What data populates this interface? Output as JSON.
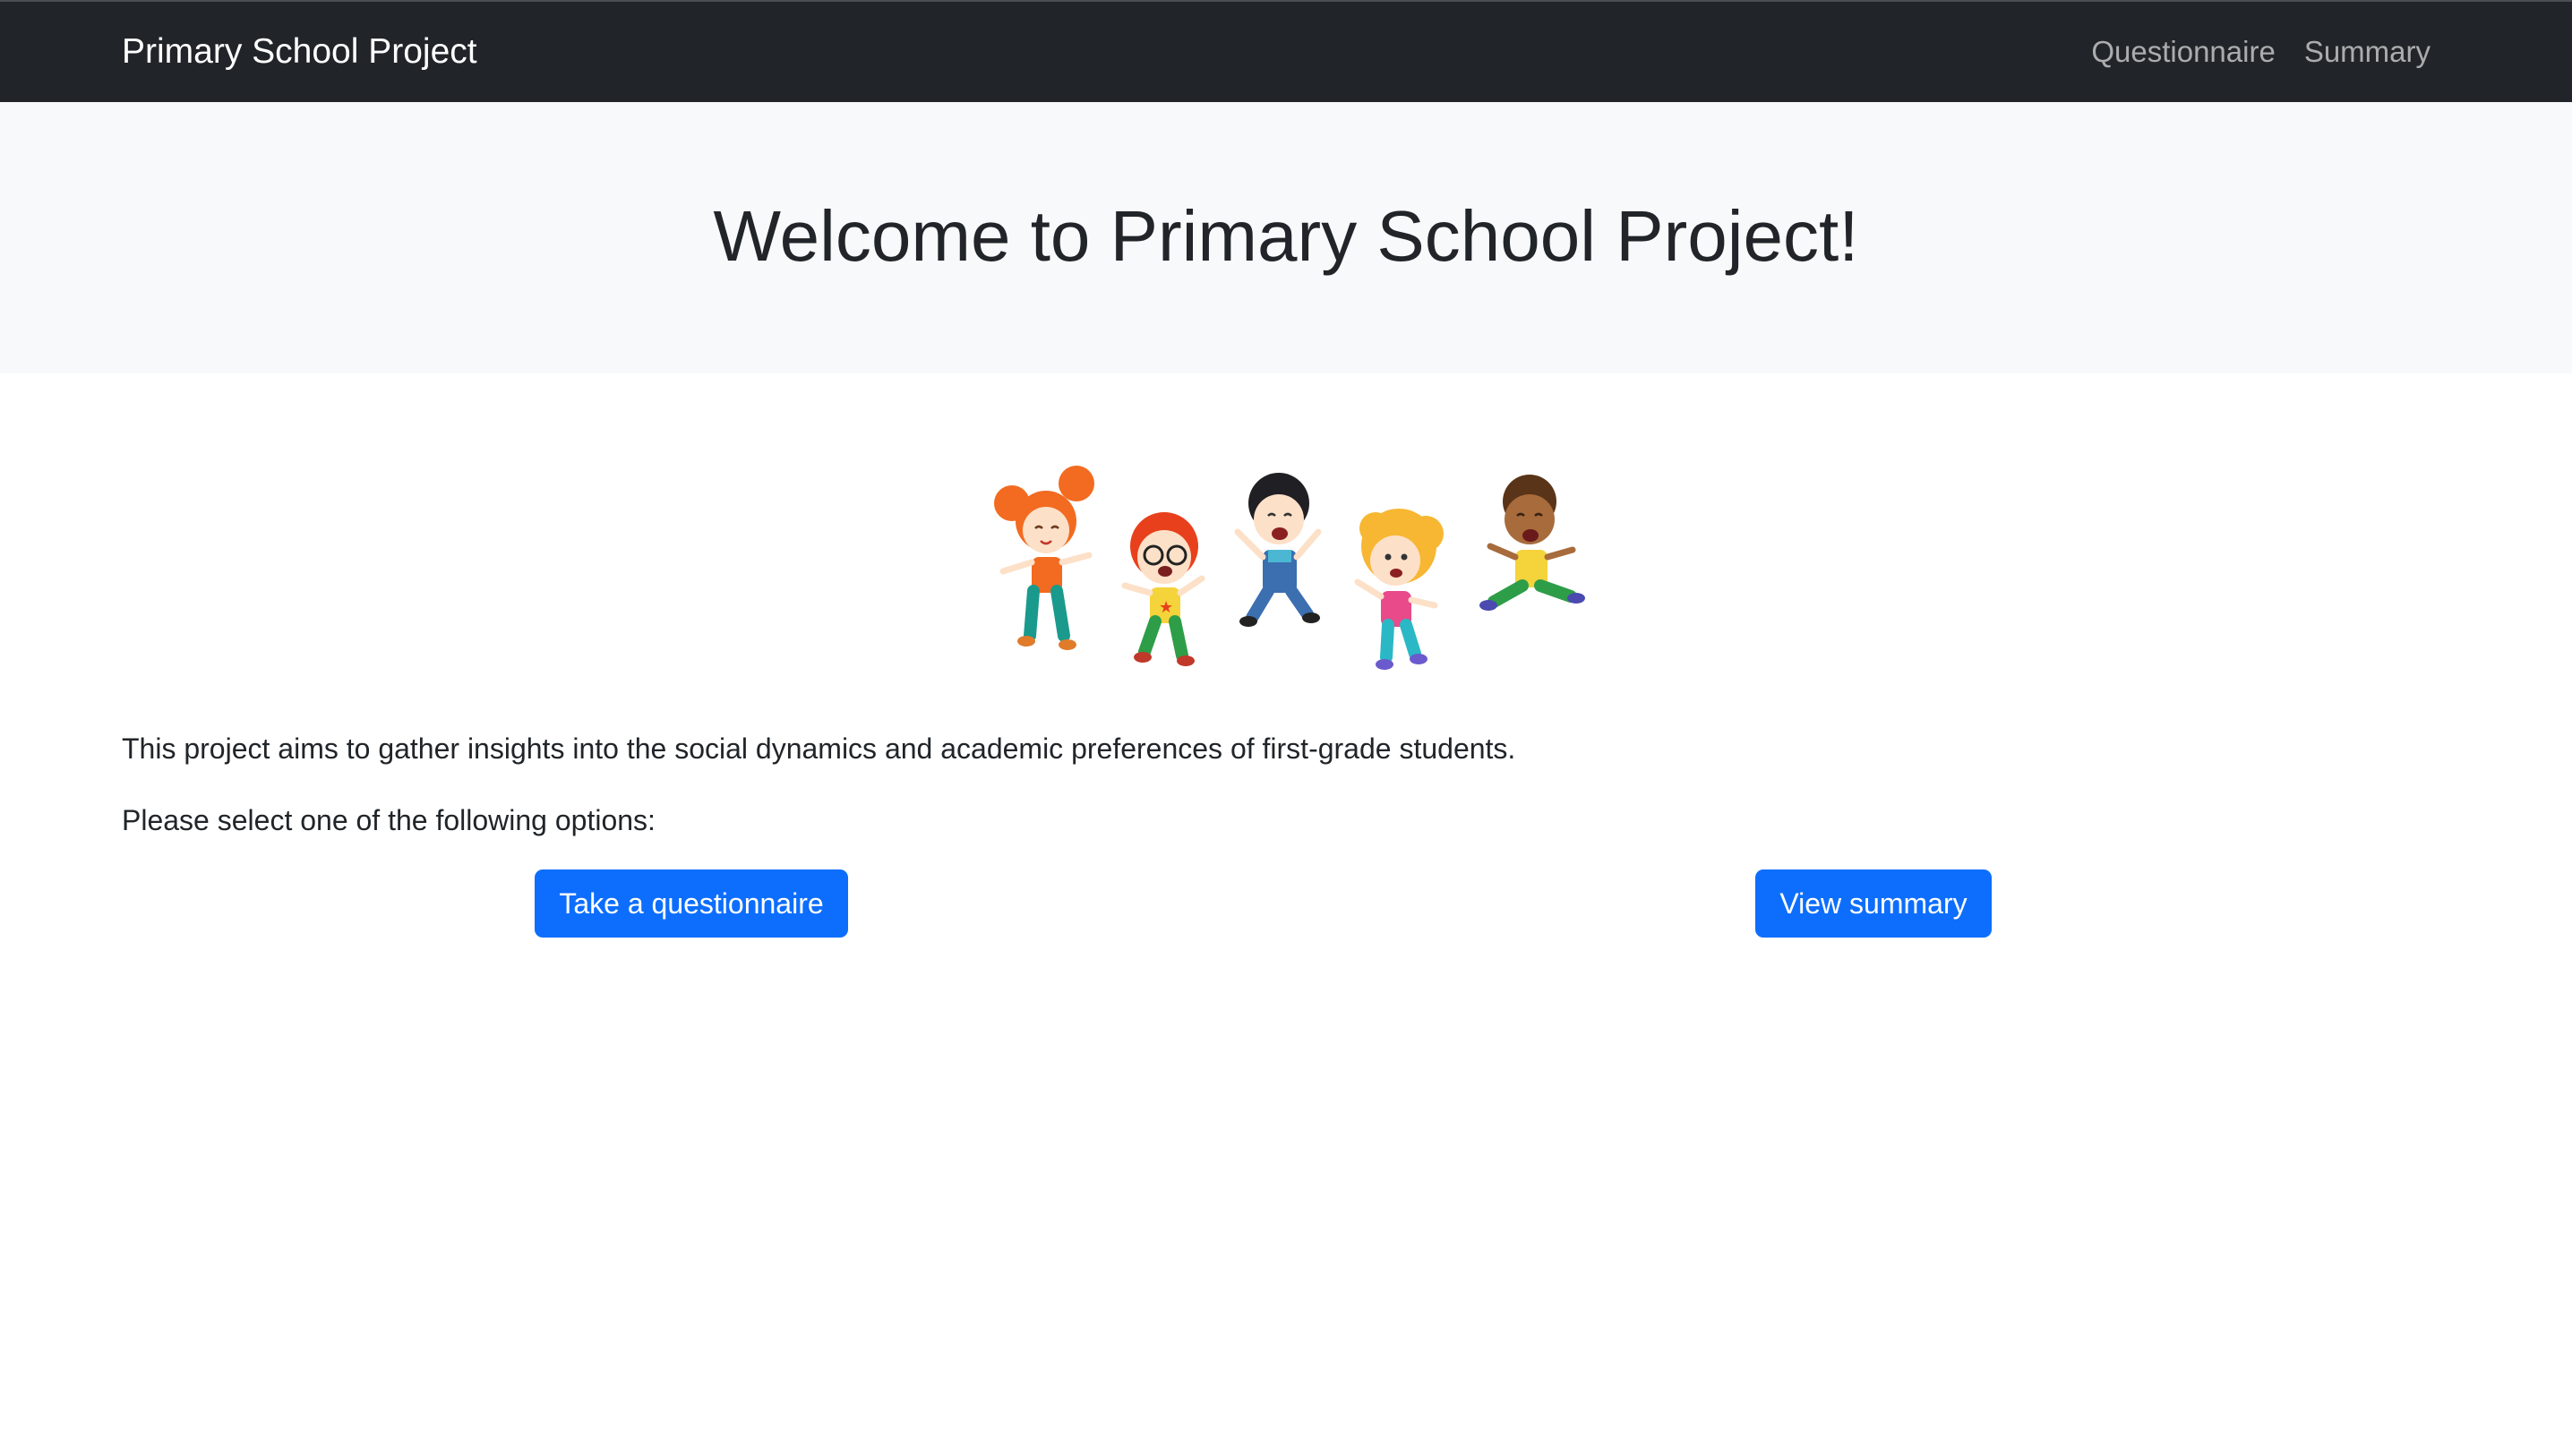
{
  "navbar": {
    "brand": "Primary School Project",
    "links": [
      {
        "label": "Questionnaire"
      },
      {
        "label": "Summary"
      }
    ]
  },
  "hero": {
    "title": "Welcome to Primary School Project!"
  },
  "main": {
    "intro": "This project aims to gather insights into the social dynamics and academic preferences of first-grade students.",
    "prompt": "Please select one of the following options:",
    "buttons": {
      "questionnaire": "Take a questionnaire",
      "summary": "View summary"
    }
  },
  "colors": {
    "navbar_bg": "#212529",
    "hero_bg": "#f8f9fa",
    "primary": "#0d6efd"
  },
  "illustration": {
    "icon": "jumping-children-illustration"
  }
}
